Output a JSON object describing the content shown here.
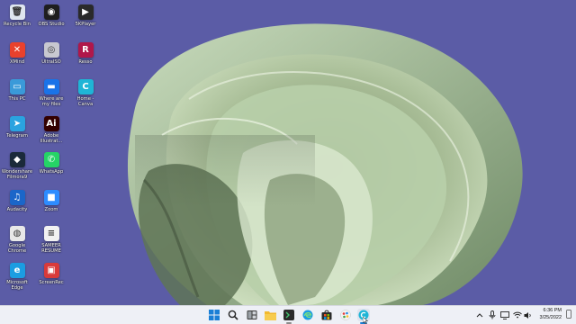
{
  "desktop": {
    "background_color": "#5b5ca6",
    "icons": [
      {
        "label": "Recycle Bin",
        "icon": "recycle-bin-icon",
        "color": "#dfe6ef",
        "glyph": "🗑"
      },
      {
        "label": "OBS Studio",
        "icon": "obs-studio-icon",
        "color": "#1e1e1e",
        "glyph": "◉"
      },
      {
        "label": "5KPlayer",
        "icon": "5kplayer-icon",
        "color": "#2a2a2a",
        "glyph": "▶"
      },
      {
        "label": "XMind",
        "icon": "xmind-icon",
        "color": "#e9412c",
        "glyph": "✕"
      },
      {
        "label": "UltraISO",
        "icon": "ultraiso-icon",
        "color": "#c8c8d0",
        "glyph": "◎"
      },
      {
        "label": "Resso",
        "icon": "resso-icon",
        "color": "#b0174a",
        "glyph": "R"
      },
      {
        "label": "This PC",
        "icon": "this-pc-icon",
        "color": "#3a9ad9",
        "glyph": "▭"
      },
      {
        "label": "Where are\nmy files",
        "icon": "folder-icon",
        "color": "#1a73e8",
        "glyph": "▬"
      },
      {
        "label": "Home -\nCanva",
        "icon": "canva-icon",
        "color": "#1fb5d6",
        "glyph": "C"
      },
      {
        "label": "Telegram",
        "icon": "telegram-icon",
        "color": "#2aa3e0",
        "glyph": "➤"
      },
      {
        "label": "Adobe\nIllustrat...",
        "icon": "adobe-illustrator-icon",
        "color": "#330000",
        "glyph": "Ai"
      },
      {
        "label": "Wondershare\nFilmora9",
        "icon": "filmora-icon",
        "color": "#1b2a3a",
        "glyph": "◆"
      },
      {
        "label": "WhatsApp",
        "icon": "whatsapp-icon",
        "color": "#25d366",
        "glyph": "✆"
      },
      {
        "label": "Audacity",
        "icon": "audacity-icon",
        "color": "#1b66c9",
        "glyph": "♫"
      },
      {
        "label": "Zoom",
        "icon": "zoom-icon",
        "color": "#2d8cff",
        "glyph": "■"
      },
      {
        "label": "Google\nChrome",
        "icon": "google-chrome-icon",
        "color": "#e8e8e8",
        "glyph": "◍"
      },
      {
        "label": "SAMEER\nRESUME",
        "icon": "document-icon",
        "color": "#f2f2f2",
        "glyph": "≡"
      },
      {
        "label": "Microsoft\nEdge",
        "icon": "microsoft-edge-icon",
        "color": "#1b9de2",
        "glyph": "e"
      },
      {
        "label": "ScreenRec",
        "icon": "screenrec-icon",
        "color": "#d93a3a",
        "glyph": "▣"
      }
    ]
  },
  "taskbar": {
    "background_color": "#eef0f6",
    "apps": [
      {
        "name": "start-button",
        "icon": "windows-start-icon"
      },
      {
        "name": "search-button",
        "icon": "search-icon"
      },
      {
        "name": "taskbar-file-explorer",
        "icon": "file-explorer-icon"
      },
      {
        "name": "taskbar-folder",
        "icon": "folder-icon"
      },
      {
        "name": "taskbar-app-pinned",
        "icon": "terminal-icon"
      },
      {
        "name": "taskbar-edge",
        "icon": "microsoft-edge-icon"
      },
      {
        "name": "taskbar-store",
        "icon": "microsoft-store-icon"
      },
      {
        "name": "taskbar-app-paint",
        "icon": "paint-icon"
      },
      {
        "name": "taskbar-app-active",
        "icon": "canva-icon"
      }
    ],
    "tray": {
      "chevron": "chevron-up-icon",
      "icons": [
        "microphone-icon",
        "display-icon",
        "wifi-icon",
        "speaker-icon",
        "battery-icon"
      ]
    },
    "clock": {
      "time": "6:36 PM",
      "date": "3/25/2022"
    }
  }
}
